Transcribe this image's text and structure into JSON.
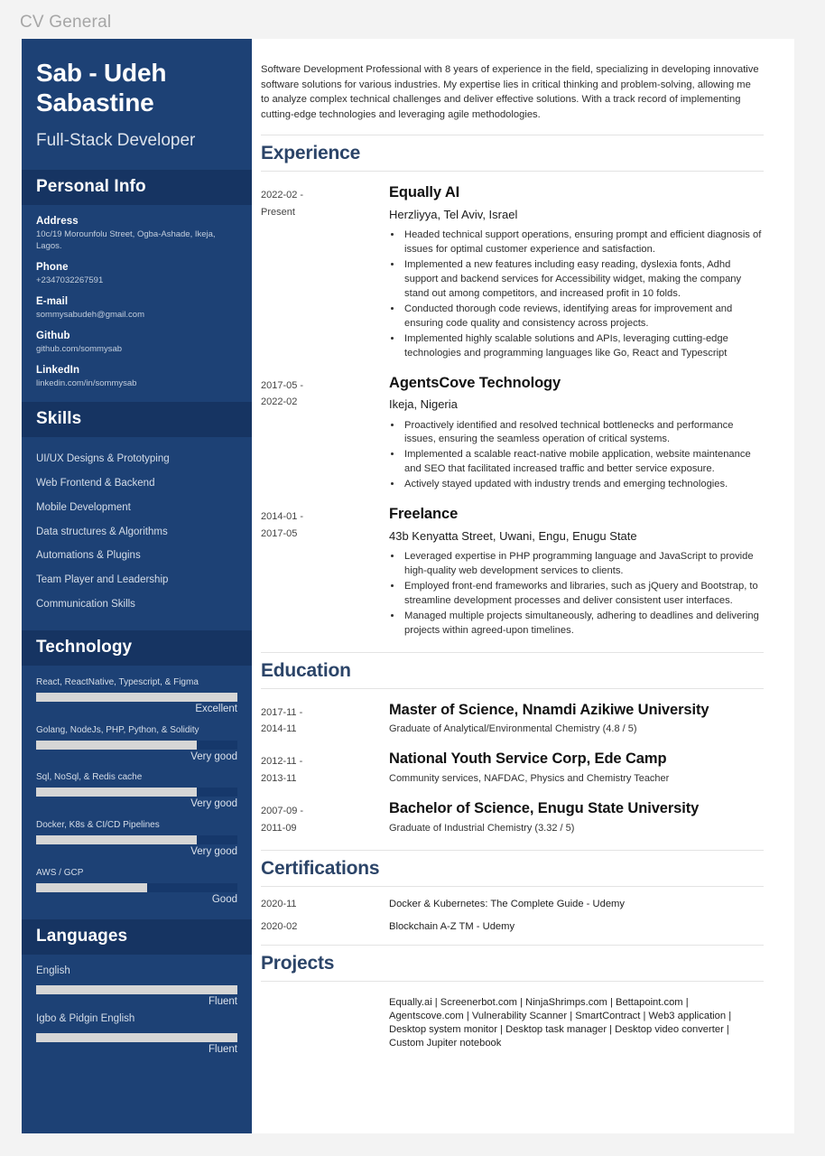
{
  "document_title": "CV General",
  "theme": {
    "sidebar_bg": "#1d4175",
    "sidebar_band_bg": "#163462",
    "heading_color": "#2b4468",
    "bar_fill": "#d6d6d6",
    "bar_track": "#16386b",
    "page_bg": "#f3f3f3"
  },
  "sidebar": {
    "name": "Sab - Udeh Sabastine",
    "title": "Full-Stack Developer",
    "personal_info": {
      "heading": "Personal Info",
      "items": [
        {
          "label": "Address",
          "value": "10c/19 Morounfolu Street, Ogba-Ashade, Ikeja, Lagos."
        },
        {
          "label": "Phone",
          "value": "+2347032267591"
        },
        {
          "label": "E-mail",
          "value": "sommysabudeh@gmail.com"
        },
        {
          "label": "Github",
          "value": "github.com/sommysab"
        },
        {
          "label": "LinkedIn",
          "value": "linkedin.com/in/sommysab"
        }
      ]
    },
    "skills": {
      "heading": "Skills",
      "items": [
        "UI/UX Designs & Prototyping",
        "Web Frontend & Backend",
        "Mobile Development",
        "Data structures & Algorithms",
        "Automations & Plugins",
        "Team Player and Leadership",
        "Communication Skills"
      ]
    },
    "technology": {
      "heading": "Technology",
      "items": [
        {
          "name": "React, ReactNative, Typescript, & Figma",
          "level": "Excellent",
          "percent": 100
        },
        {
          "name": "Golang, NodeJs, PHP, Python, & Solidity",
          "level": "Very good",
          "percent": 80
        },
        {
          "name": "Sql, NoSql, & Redis cache",
          "level": "Very good",
          "percent": 80
        },
        {
          "name": "Docker, K8s & CI/CD Pipelines",
          "level": "Very good",
          "percent": 80
        },
        {
          "name": "AWS / GCP",
          "level": "Good",
          "percent": 55
        }
      ]
    },
    "languages": {
      "heading": "Languages",
      "items": [
        {
          "name": "English",
          "level": "Fluent",
          "percent": 100
        },
        {
          "name": "Igbo & Pidgin English",
          "level": "Fluent",
          "percent": 100
        }
      ]
    }
  },
  "main": {
    "summary": "Software Development Professional with 8 years of experience in the field, specializing in developing innovative software solutions for various industries. My expertise lies in critical thinking and problem-solving, allowing me to analyze complex technical challenges and deliver effective solutions. With a track record of implementing cutting-edge technologies and leveraging agile methodologies.",
    "experience": {
      "heading": "Experience",
      "entries": [
        {
          "date_from": "2022-02  -",
          "date_to": "Present",
          "title": "Equally AI",
          "location": "Herzliyya, Tel Aviv, Israel",
          "bullets": [
            "Headed technical support operations, ensuring prompt and efficient diagnosis of issues for optimal customer experience and satisfaction.",
            "Implemented a new features including easy reading, dyslexia fonts, Adhd support and backend services for Accessibility widget, making the company stand out among competitors, and increased profit in 10 folds.",
            "Conducted thorough code reviews, identifying areas for improvement and ensuring code quality and consistency across projects.",
            "Implemented highly scalable solutions and APIs, leveraging cutting-edge technologies and programming languages like Go, React and Typescript"
          ]
        },
        {
          "date_from": "2017-05  -",
          "date_to": "2022-02",
          "title": "AgentsCove Technology",
          "location": "Ikeja, Nigeria",
          "bullets": [
            "Proactively identified and resolved technical bottlenecks and performance issues, ensuring the seamless operation of critical systems.",
            "Implemented a scalable react-native mobile application, website maintenance and SEO that facilitated increased traffic and better service exposure.",
            "Actively stayed updated with industry trends and emerging technologies."
          ]
        },
        {
          "date_from": "2014-01  -",
          "date_to": "2017-05",
          "title": "Freelance",
          "location": "43b Kenyatta Street, Uwani, Engu, Enugu State",
          "bullets": [
            "Leveraged expertise in PHP programming language and JavaScript to provide high-quality web development services to clients.",
            "Employed front-end frameworks and libraries, such as jQuery and Bootstrap, to streamline development processes and deliver consistent user interfaces.",
            "Managed multiple projects simultaneously, adhering to deadlines and delivering projects within agreed-upon timelines."
          ]
        }
      ]
    },
    "education": {
      "heading": "Education",
      "entries": [
        {
          "date_from": "2017-11 -",
          "date_to": "2014-11",
          "title": "Master of Science, Nnamdi Azikiwe University",
          "detail": "Graduate of Analytical/Environmental Chemistry (4.8 / 5)"
        },
        {
          "date_from": "2012-11 -",
          "date_to": "2013-11",
          "title": "National Youth Service Corp, Ede Camp",
          "detail": "Community services, NAFDAC, Physics and Chemistry Teacher"
        },
        {
          "date_from": "2007-09 -",
          "date_to": "2011-09",
          "title": "Bachelor of Science, Enugu State University",
          "detail": "Graduate of Industrial Chemistry (3.32 / 5)"
        }
      ]
    },
    "certifications": {
      "heading": "Certifications",
      "entries": [
        {
          "date": "2020-11",
          "name": "Docker & Kubernetes: The Complete Guide - Udemy"
        },
        {
          "date": "2020-02",
          "name": "Blockchain A-Z TM - Udemy"
        }
      ]
    },
    "projects": {
      "heading": "Projects",
      "list": "Equally.ai |  Screenerbot.com | NinjaShrimps.com | Bettapoint.com | Agentscove.com | Vulnerability Scanner | SmartContract | Web3 application | Desktop system monitor | Desktop task manager | Desktop video converter | Custom Jupiter notebook"
    }
  }
}
